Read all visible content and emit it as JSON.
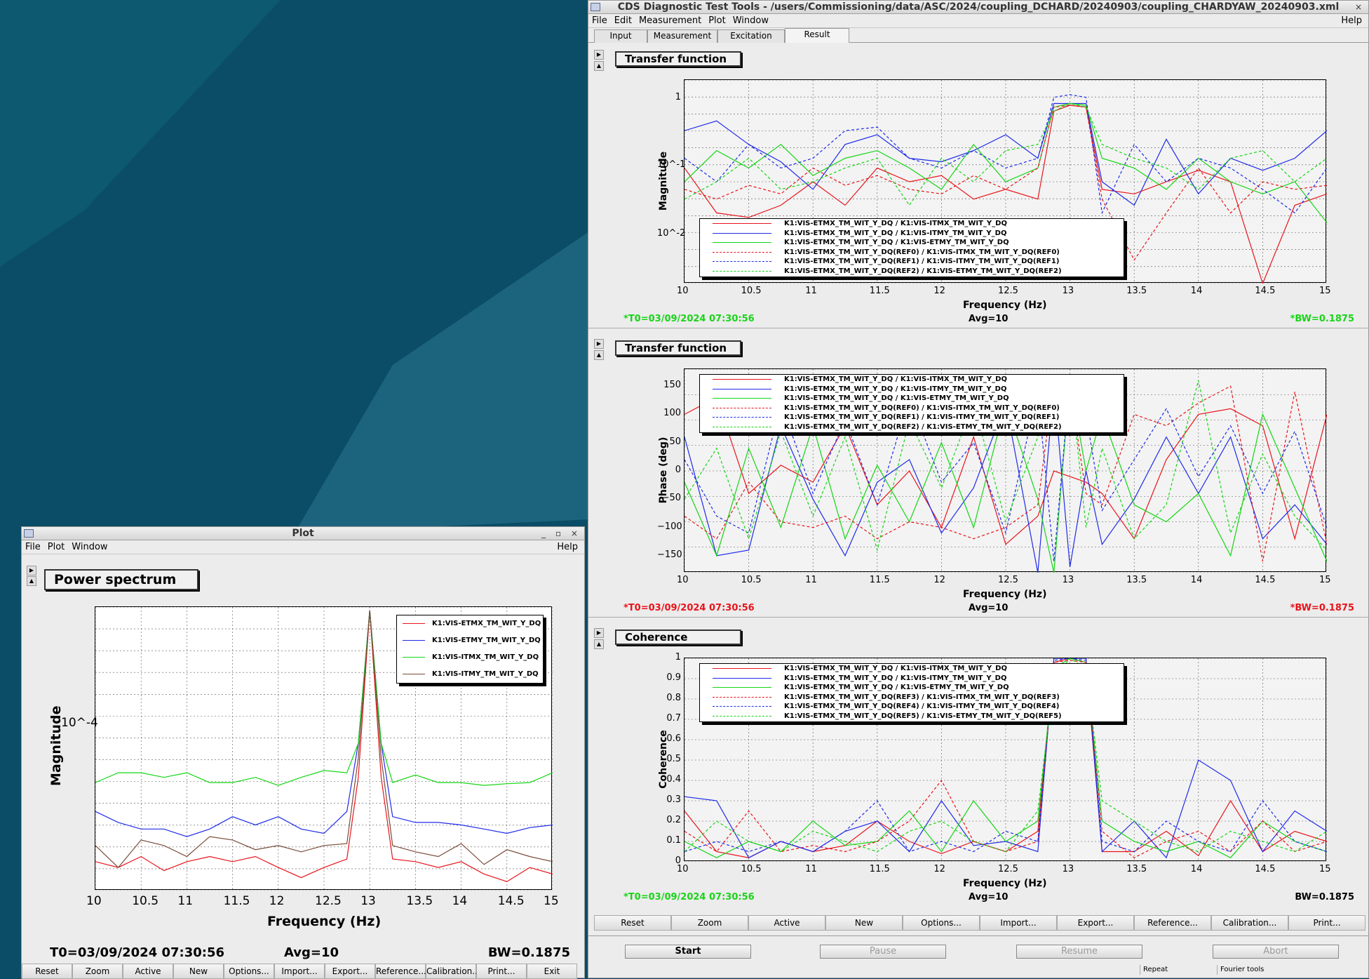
{
  "colors": {
    "red": "#e8141b",
    "blue": "#1f2be8",
    "green": "#14d614",
    "brown": "#7a4b3a",
    "desktop": "#0b4d66",
    "info_green": "#19d419",
    "info_red": "#e8141b"
  },
  "main": {
    "title": "CDS Diagnostic Test Tools - /users/Commissioning/data/ASC/2024/coupling_DCHARD/20240903/coupling_CHARDYAW_20240903.xml",
    "menu": [
      "File",
      "Edit",
      "Measurement",
      "Plot",
      "Window"
    ],
    "help": "Help",
    "tabs": [
      "Input",
      "Measurement",
      "Excitation",
      "Result"
    ],
    "panels": [
      {
        "title": "Transfer function",
        "ylabel": "Magnitude",
        "xlabel": "Frequency (Hz)",
        "xticks": [
          "10",
          "10.5",
          "11",
          "11.5",
          "12",
          "12.5",
          "13",
          "13.5",
          "14",
          "14.5",
          "15"
        ],
        "yticks": [
          "1",
          "10^-1",
          "10^-2"
        ],
        "info_left": "*T0=03/09/2024 07:30:56",
        "info_mid": "Avg=10",
        "info_right": "*BW=0.1875",
        "legend": [
          "K1:VIS-ETMX_TM_WIT_Y_DQ / K1:VIS-ITMX_TM_WIT_Y_DQ",
          "K1:VIS-ETMX_TM_WIT_Y_DQ / K1:VIS-ITMY_TM_WIT_Y_DQ",
          "K1:VIS-ETMX_TM_WIT_Y_DQ / K1:VIS-ETMY_TM_WIT_Y_DQ",
          "K1:VIS-ETMX_TM_WIT_Y_DQ(REF0) / K1:VIS-ITMX_TM_WIT_Y_DQ(REF0)",
          "K1:VIS-ETMX_TM_WIT_Y_DQ(REF1) / K1:VIS-ITMY_TM_WIT_Y_DQ(REF1)",
          "K1:VIS-ETMX_TM_WIT_Y_DQ(REF2) / K1:VIS-ETMY_TM_WIT_Y_DQ(REF2)"
        ]
      },
      {
        "title": "Transfer function",
        "ylabel": "Phase (deg)",
        "xlabel": "Frequency (Hz)",
        "xticks": [
          "10",
          "10.5",
          "11",
          "11.5",
          "12",
          "12.5",
          "13",
          "13.5",
          "14",
          "14.5",
          "15"
        ],
        "yticks": [
          "150",
          "100",
          "50",
          "0",
          "−50",
          "−100",
          "−150"
        ],
        "info_left": "*T0=03/09/2024 07:30:56",
        "info_mid": "Avg=10",
        "info_right": "*BW=0.1875",
        "legend": [
          "K1:VIS-ETMX_TM_WIT_Y_DQ / K1:VIS-ITMX_TM_WIT_Y_DQ",
          "K1:VIS-ETMX_TM_WIT_Y_DQ / K1:VIS-ITMY_TM_WIT_Y_DQ",
          "K1:VIS-ETMX_TM_WIT_Y_DQ / K1:VIS-ETMY_TM_WIT_Y_DQ",
          "K1:VIS-ETMX_TM_WIT_Y_DQ(REF0) / K1:VIS-ITMX_TM_WIT_Y_DQ(REF0)",
          "K1:VIS-ETMX_TM_WIT_Y_DQ(REF1) / K1:VIS-ITMY_TM_WIT_Y_DQ(REF1)",
          "K1:VIS-ETMX_TM_WIT_Y_DQ(REF2) / K1:VIS-ETMY_TM_WIT_Y_DQ(REF2)"
        ]
      },
      {
        "title": "Coherence",
        "ylabel": "Coherence",
        "xlabel": "Frequency (Hz)",
        "xticks": [
          "10",
          "10.5",
          "11",
          "11.5",
          "12",
          "12.5",
          "13",
          "13.5",
          "14",
          "14.5",
          "15"
        ],
        "yticks": [
          "1",
          "0.9",
          "0.8",
          "0.7",
          "0.6",
          "0.5",
          "0.4",
          "0.3",
          "0.2",
          "0.1",
          "0"
        ],
        "info_left": "*T0=03/09/2024 07:30:56",
        "info_mid": "Avg=10",
        "info_right": "BW=0.1875",
        "legend": [
          "K1:VIS-ETMX_TM_WIT_Y_DQ / K1:VIS-ITMX_TM_WIT_Y_DQ",
          "K1:VIS-ETMX_TM_WIT_Y_DQ / K1:VIS-ITMY_TM_WIT_Y_DQ",
          "K1:VIS-ETMX_TM_WIT_Y_DQ / K1:VIS-ETMY_TM_WIT_Y_DQ",
          "K1:VIS-ETMX_TM_WIT_Y_DQ(REF3) / K1:VIS-ITMX_TM_WIT_Y_DQ(REF3)",
          "K1:VIS-ETMX_TM_WIT_Y_DQ(REF4) / K1:VIS-ITMY_TM_WIT_Y_DQ(REF4)",
          "K1:VIS-ETMX_TM_WIT_Y_DQ(REF5) / K1:VIS-ETMY_TM_WIT_Y_DQ(REF5)"
        ]
      }
    ],
    "buttons": [
      "Reset",
      "Zoom",
      "Active",
      "New",
      "Options...",
      "Import...",
      "Export...",
      "Reference...",
      "Calibration...",
      "Print..."
    ],
    "controls": [
      "Start",
      "Pause",
      "Resume",
      "Abort"
    ],
    "status": [
      "Repeat",
      "Fourier tools"
    ]
  },
  "plotwin": {
    "title": "Plot",
    "menu": [
      "File",
      "Plot",
      "Window"
    ],
    "help": "Help",
    "panel_title": "Power spectrum",
    "ylabel": "Magnitude",
    "xlabel": "Frequency (Hz)",
    "xticks": [
      "10",
      "10.5",
      "11",
      "11.5",
      "12",
      "12.5",
      "13",
      "13.5",
      "14",
      "14.5",
      "15"
    ],
    "ytick": "10^-4",
    "legend": [
      "K1:VIS-ETMX_TM_WIT_Y_DQ",
      "K1:VIS-ETMY_TM_WIT_Y_DQ",
      "K1:VIS-ITMX_TM_WIT_Y_DQ",
      "K1:VIS-ITMY_TM_WIT_Y_DQ"
    ],
    "info_left": "T0=03/09/2024 07:30:56",
    "info_mid": "Avg=10",
    "info_right": "BW=0.1875",
    "buttons": [
      "Reset",
      "Zoom",
      "Active",
      "New",
      "Options...",
      "Import...",
      "Export...",
      "Reference...",
      "Calibration...",
      "Print...",
      "Exit"
    ]
  },
  "chart_data": [
    {
      "type": "line",
      "title": "Transfer function",
      "xlabel": "Frequency (Hz)",
      "ylabel": "Magnitude",
      "xlim": [
        10,
        15
      ],
      "ylim": [
        0.005,
        2
      ],
      "yscale": "log",
      "x": [
        10,
        10.25,
        10.5,
        10.75,
        11,
        11.25,
        11.5,
        11.75,
        12,
        12.25,
        12.5,
        12.75,
        12.875,
        13,
        13.125,
        13.25,
        13.5,
        13.75,
        14,
        14.25,
        14.5,
        14.75,
        15
      ],
      "series": [
        {
          "name": "K1:VIS-ETMX_TM_WIT_Y_DQ / K1:VIS-ITMX_TM_WIT_Y_DQ",
          "values": [
            0.15,
            0.04,
            0.035,
            0.05,
            0.1,
            0.05,
            0.15,
            0.1,
            0.12,
            0.06,
            0.08,
            0.06,
            0.8,
            0.95,
            0.9,
            0.08,
            0.07,
            0.1,
            0.14,
            0.1,
            0.005,
            0.05,
            0.07
          ]
        },
        {
          "name": "K1:VIS-ETMX_TM_WIT_Y_DQ / K1:VIS-ITMY_TM_WIT_Y_DQ",
          "values": [
            0.45,
            0.6,
            0.3,
            0.18,
            0.08,
            0.3,
            0.4,
            0.2,
            0.18,
            0.25,
            0.4,
            0.2,
            1.0,
            1.0,
            1.0,
            0.1,
            0.05,
            0.35,
            0.07,
            0.2,
            0.14,
            0.2,
            0.45
          ]
        },
        {
          "name": "K1:VIS-ETMX_TM_WIT_Y_DQ / K1:VIS-ETMY_TM_WIT_Y_DQ",
          "values": [
            0.1,
            0.25,
            0.15,
            0.3,
            0.12,
            0.2,
            0.25,
            0.15,
            0.08,
            0.3,
            0.1,
            0.15,
            0.9,
            1.0,
            0.95,
            0.2,
            0.15,
            0.08,
            0.2,
            0.1,
            0.07,
            0.1,
            0.03
          ]
        },
        {
          "name": "K1:VIS-ETMX_TM_WIT_Y_DQ(REF0) / K1:VIS-ITMX_TM_WIT_Y_DQ(REF0)",
          "values": [
            0.08,
            0.06,
            0.09,
            0.07,
            0.15,
            0.09,
            0.12,
            0.08,
            0.07,
            0.12,
            0.08,
            0.15,
            0.9,
            0.95,
            0.9,
            0.06,
            0.01,
            0.04,
            0.15,
            0.04,
            0.1,
            0.08,
            0.09
          ]
        },
        {
          "name": "K1:VIS-ETMX_TM_WIT_Y_DQ(REF1) / K1:VIS-ITMY_TM_WIT_Y_DQ(REF1)",
          "values": [
            0.2,
            0.1,
            0.3,
            0.15,
            0.2,
            0.45,
            0.5,
            0.2,
            0.15,
            0.25,
            0.15,
            0.2,
            1.2,
            1.3,
            1.2,
            0.04,
            0.3,
            0.1,
            0.2,
            0.15,
            0.08,
            0.04,
            0.15
          ]
        },
        {
          "name": "K1:VIS-ETMX_TM_WIT_Y_DQ(REF2) / K1:VIS-ETMY_TM_WIT_Y_DQ(REF2)",
          "values": [
            0.06,
            0.1,
            0.2,
            0.08,
            0.1,
            0.15,
            0.2,
            0.05,
            0.2,
            0.1,
            0.25,
            0.3,
            0.8,
            1.0,
            0.9,
            0.3,
            0.2,
            0.15,
            0.08,
            0.2,
            0.25,
            0.1,
            0.2
          ]
        }
      ]
    },
    {
      "type": "line",
      "title": "Transfer function",
      "xlabel": "Frequency (Hz)",
      "ylabel": "Phase (deg)",
      "xlim": [
        10,
        15
      ],
      "ylim": [
        -180,
        180
      ],
      "x": [
        10,
        10.25,
        10.5,
        10.75,
        11,
        11.25,
        11.5,
        11.75,
        12,
        12.25,
        12.5,
        12.75,
        12.875,
        13,
        13.125,
        13.25,
        13.5,
        13.75,
        14,
        14.25,
        14.5,
        14.75,
        15
      ],
      "series": [
        {
          "name": "K1:VIS-ETMX_TM_WIT_Y_DQ / K1:VIS-ITMX_TM_WIT_Y_DQ",
          "values": [
            100,
            130,
            -40,
            10,
            -20,
            80,
            -60,
            0,
            -100,
            60,
            -130,
            -80,
            0,
            -10,
            -20,
            -40,
            -120,
            20,
            100,
            110,
            80,
            -120,
            100
          ]
        },
        {
          "name": "K1:VIS-ETMX_TM_WIT_Y_DQ / K1:VIS-ITMY_TM_WIT_Y_DQ",
          "values": [
            60,
            -150,
            -140,
            80,
            -50,
            -150,
            -20,
            20,
            -110,
            -30,
            120,
            -180,
            150,
            -170,
            0,
            -130,
            -50,
            60,
            -40,
            60,
            -120,
            -60,
            -130
          ]
        },
        {
          "name": "K1:VIS-ETMX_TM_WIT_Y_DQ / K1:VIS-ITMY_TM_WIT_Y_DQ",
          "values": [
            -20,
            -150,
            40,
            -100,
            80,
            -120,
            10,
            -90,
            50,
            -100,
            120,
            -50,
            -180,
            160,
            0,
            100,
            -60,
            -90,
            -40,
            -150,
            100,
            -30,
            -160
          ]
        },
        {
          "name": "K1:VIS-ETMX_TM_WIT_Y_DQ(REF0) / K1:VIS-ITMX_TM_WIT_Y_DQ(REF0)",
          "values": [
            -80,
            -120,
            -20,
            -90,
            -100,
            -80,
            -120,
            -90,
            -100,
            -120,
            -100,
            -60,
            160,
            150,
            -40,
            -60,
            100,
            80,
            120,
            150,
            -160,
            140,
            -130
          ]
        },
        {
          "name": "K1:VIS-ETMX_TM_WIT_Y_DQ(REF1) / K1:VIS-ITMY_TM_WIT_Y_DQ(REF1)",
          "values": [
            20,
            -80,
            -110,
            120,
            -40,
            90,
            -60,
            130,
            -20,
            50,
            -110,
            140,
            -160,
            160,
            100,
            -70,
            20,
            110,
            -10,
            80,
            -40,
            70,
            -100
          ]
        },
        {
          "name": "K1:VIS-ETMX_TM_WIT_Y_DQ(REF2) / K1:VIS-ETMY_TM_WIT_Y_DQ(REF2)",
          "values": [
            -50,
            40,
            -120,
            70,
            -80,
            60,
            -140,
            90,
            -30,
            120,
            -90,
            60,
            130,
            170,
            -100,
            40,
            -120,
            -60,
            160,
            -110,
            30,
            -80,
            -140
          ]
        }
      ]
    },
    {
      "type": "line",
      "title": "Coherence",
      "xlabel": "Frequency (Hz)",
      "ylabel": "Coherence",
      "xlim": [
        10,
        15
      ],
      "ylim": [
        0,
        1
      ],
      "x": [
        10,
        10.25,
        10.5,
        10.75,
        11,
        11.25,
        11.5,
        11.75,
        12,
        12.25,
        12.5,
        12.75,
        12.875,
        13,
        13.125,
        13.25,
        13.5,
        13.75,
        14,
        14.25,
        14.5,
        14.75,
        15
      ],
      "series": [
        {
          "name": "K1:VIS-ETMX_TM_WIT_Y_DQ / K1:VIS-ITMX_TM_WIT_Y_DQ",
          "values": [
            0.25,
            0.05,
            0.02,
            0.1,
            0.05,
            0.08,
            0.2,
            0.1,
            0.04,
            0.1,
            0.05,
            0.15,
            0.98,
            1.0,
            0.98,
            0.05,
            0.05,
            0.15,
            0.03,
            0.3,
            0.05,
            0.15,
            0.1
          ]
        },
        {
          "name": "K1:VIS-ETMX_TM_WIT_Y_DQ / K1:VIS-ITMY_TM_WIT_Y_DQ",
          "values": [
            0.32,
            0.3,
            0.02,
            0.1,
            0.05,
            0.15,
            0.2,
            0.05,
            0.3,
            0.08,
            0.1,
            0.05,
            1.0,
            1.0,
            1.0,
            0.05,
            0.2,
            0.02,
            0.5,
            0.4,
            0.05,
            0.25,
            0.15
          ]
        },
        {
          "name": "K1:VIS-ETMX_TM_WIT_Y_DQ / K1:VIS-ETMY_TM_WIT_Y_DQ",
          "values": [
            0.1,
            0.02,
            0.1,
            0.05,
            0.2,
            0.08,
            0.1,
            0.25,
            0.05,
            0.3,
            0.1,
            0.2,
            0.95,
            1.0,
            0.98,
            0.2,
            0.1,
            0.05,
            0.1,
            0.02,
            0.2,
            0.1,
            0.05
          ]
        },
        {
          "name": "K1:VIS-ETMX_TM_WIT_Y_DQ(REF3) / K1:VIS-ITMX_TM_WIT_Y_DQ(REF3)",
          "values": [
            0.15,
            0.05,
            0.25,
            0.05,
            0.08,
            0.05,
            0.1,
            0.2,
            0.4,
            0.1,
            0.05,
            0.1,
            0.98,
            0.99,
            0.98,
            0.15,
            0.02,
            0.1,
            0.15,
            0.05,
            0.2,
            0.05,
            0.1
          ]
        },
        {
          "name": "K1:VIS-ETMX_TM_WIT_Y_DQ(REF4) / K1:VIS-ITMY_TM_WIT_Y_DQ(REF4)",
          "values": [
            0.05,
            0.1,
            0.05,
            0.1,
            0.05,
            0.15,
            0.3,
            0.05,
            0.1,
            0.05,
            0.15,
            0.1,
            0.99,
            1.0,
            0.99,
            0.1,
            0.05,
            0.2,
            0.1,
            0.05,
            0.3,
            0.1,
            0.05
          ]
        },
        {
          "name": "K1:VIS-ETMX_TM_WIT_Y_DQ(REF5) / K1:VIS-ETMY_TM_WIT_Y_DQ(REF5)",
          "values": [
            0.05,
            0.2,
            0.1,
            0.05,
            0.15,
            0.1,
            0.05,
            0.15,
            0.2,
            0.1,
            0.05,
            0.25,
            0.9,
            1.0,
            0.95,
            0.3,
            0.2,
            0.1,
            0.05,
            0.15,
            0.1,
            0.05,
            0.15
          ]
        }
      ]
    },
    {
      "type": "line",
      "title": "Power spectrum",
      "xlabel": "Frequency (Hz)",
      "ylabel": "Magnitude",
      "xlim": [
        10,
        15
      ],
      "yscale": "log",
      "x": [
        10,
        10.25,
        10.5,
        10.75,
        11,
        11.25,
        11.5,
        11.75,
        12,
        12.25,
        12.5,
        12.75,
        12.875,
        13,
        13.125,
        13.25,
        13.5,
        13.75,
        14,
        14.25,
        14.5,
        14.75,
        15
      ],
      "series": [
        {
          "name": "K1:VIS-ETMX_TM_WIT_Y_DQ",
          "values": [
            1.8e-05,
            1.6e-05,
            2e-05,
            1.5e-05,
            1.8e-05,
            2e-05,
            1.8e-05,
            2e-05,
            1.6e-05,
            1.3e-05,
            1.6e-05,
            1.9e-05,
            0.0001,
            0.003,
            0.0001,
            1.9e-05,
            1.8e-05,
            1.6e-05,
            1.8e-05,
            1.4e-05,
            1.2e-05,
            1.6e-05,
            1.4e-05
          ]
        },
        {
          "name": "K1:VIS-ETMY_TM_WIT_Y_DQ",
          "values": [
            5e-05,
            4e-05,
            3.5e-05,
            3.5e-05,
            3e-05,
            3.5e-05,
            4.5e-05,
            3.8e-05,
            4.5e-05,
            3.5e-05,
            3.2e-05,
            5e-05,
            0.0002,
            0.003,
            0.0002,
            4.5e-05,
            4e-05,
            4e-05,
            3.8e-05,
            3.5e-05,
            3.2e-05,
            3.6e-05,
            3.8e-05
          ]
        },
        {
          "name": "K1:VIS-ITMX_TM_WIT_Y_DQ",
          "values": [
            9e-05,
            0.00011,
            0.00011,
            0.0001,
            0.00011,
            9e-05,
            9e-05,
            0.0001,
            8.5e-05,
            0.0001,
            0.000115,
            0.00011,
            0.0002,
            0.003,
            0.0002,
            9e-05,
            0.000105,
            9e-05,
            9e-05,
            8.5e-05,
            8.8e-05,
            9e-05,
            0.00011
          ]
        },
        {
          "name": "K1:VIS-ITMY_TM_WIT_Y_DQ",
          "values": [
            2.5e-05,
            1.6e-05,
            2.8e-05,
            2.5e-05,
            2e-05,
            3e-05,
            2.8e-05,
            2.3e-05,
            2.5e-05,
            2.2e-05,
            2.5e-05,
            2.6e-05,
            0.00015,
            0.003,
            0.00015,
            2.5e-05,
            2.2e-05,
            2e-05,
            2.6e-05,
            1.7e-05,
            2.3e-05,
            2e-05,
            1.8e-05
          ]
        }
      ]
    }
  ]
}
